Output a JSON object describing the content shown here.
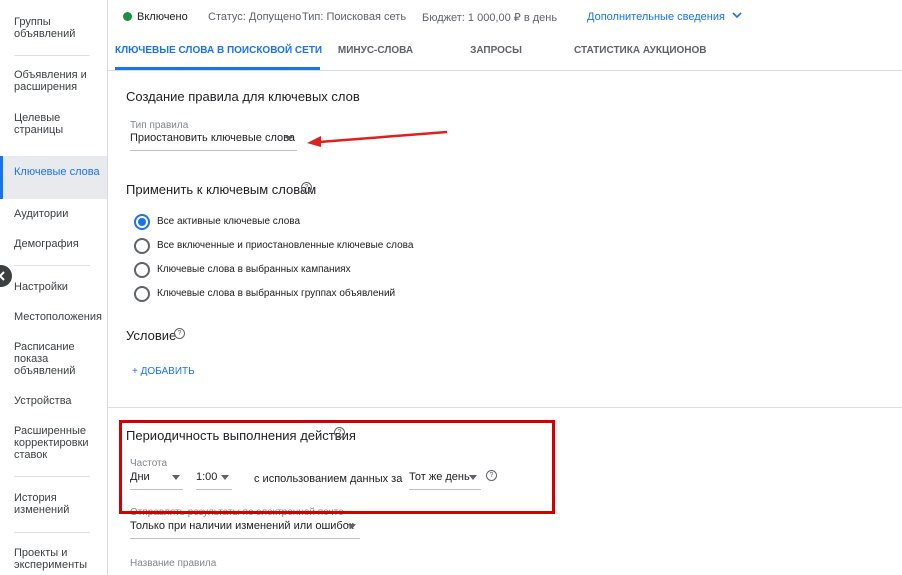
{
  "sidebar": {
    "items": [
      {
        "label": "Группы объявлений"
      },
      {
        "label": "Объявления и расширения"
      },
      {
        "label": "Целевые страницы"
      },
      {
        "label": "Ключевые слова"
      },
      {
        "label": "Аудитории"
      },
      {
        "label": "Демография"
      },
      {
        "label": "Настройки"
      },
      {
        "label": "Местоположения"
      },
      {
        "label": "Расписание показа объявлений"
      },
      {
        "label": "Устройства"
      },
      {
        "label": "Расширенные корректировки ставок"
      },
      {
        "label": "История изменений"
      },
      {
        "label": "Проекты и эксперименты"
      }
    ]
  },
  "status_bar": {
    "state": "Включено",
    "status": "Статус: Допущено",
    "type": "Тип: Поисковая сеть",
    "budget": "Бюджет: 1 000,00 ₽ в день",
    "more": "Дополнительные сведения"
  },
  "tabs": [
    "КЛЮЧЕВЫЕ СЛОВА В ПОИСКОВОЙ СЕТИ",
    "МИНУС-СЛОВА",
    "ЗАПРОСЫ",
    "СТАТИСТИКА АУКЦИОНОВ"
  ],
  "form": {
    "title": "Создание правила для ключевых слов",
    "rule_type_label": "Тип правила",
    "rule_type_value": "Приостановить ключевые слова",
    "apply_title": "Применить к ключевым словам",
    "apply_options": [
      "Все активные ключевые слова",
      "Все включенные и приостановленные ключевые слова",
      "Ключевые слова в выбранных кампаниях",
      "Ключевые слова в выбранных группах объявлений"
    ],
    "condition_title": "Условие",
    "add_label": "+ ДОБАВИТЬ",
    "frequency_title": "Периодичность выполнения действия",
    "frequency_label": "Частота",
    "frequency_value": "Дни",
    "time_value": "1:00",
    "using_data_text": "с использованием данных за",
    "data_range_value": "Тот же день",
    "email_label": "Отправлять результаты по электронной почте",
    "email_value": "Только при наличии изменений или ошибок",
    "rule_name_label": "Название правила"
  },
  "colors": {
    "accent": "#1a73e8",
    "highlight_box": "#d20000",
    "annotation_arrow": "#e0201c",
    "status_green": "#1e8e3e"
  },
  "icons": [
    "chevron-down-icon",
    "help-icon",
    "dropdown-triangle-icon",
    "collapse-arrow-icon",
    "red-arrow-annotation"
  ]
}
